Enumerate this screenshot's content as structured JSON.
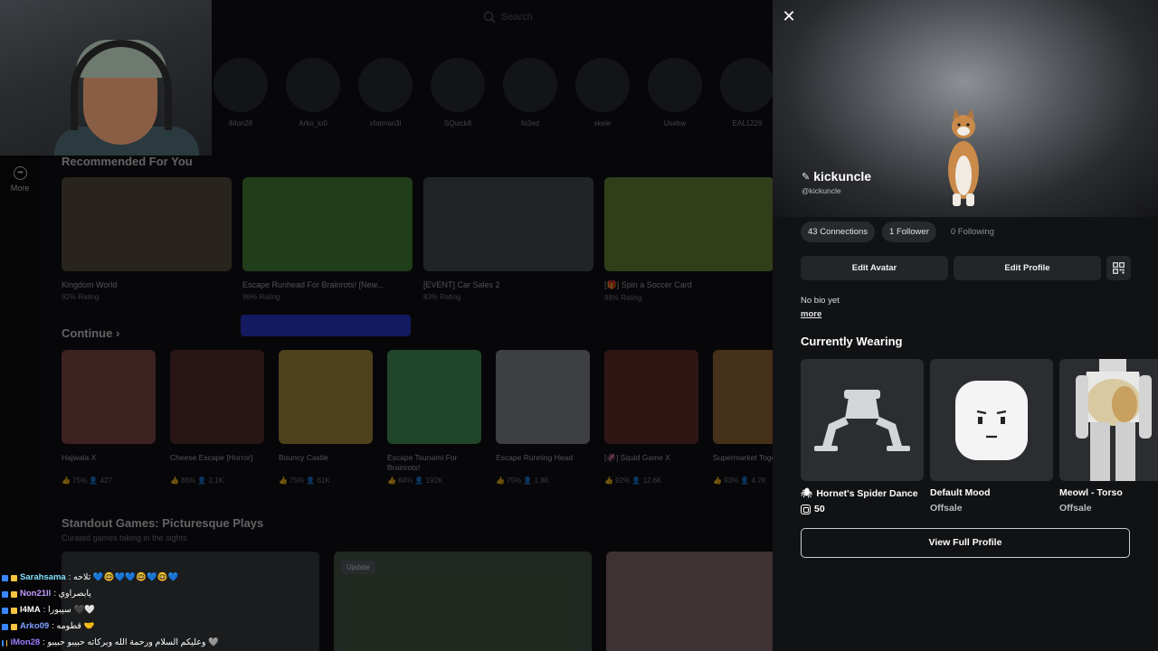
{
  "home": {
    "search_placeholder": "Search",
    "more_label": "More",
    "friends": [
      "iMon28",
      "Arko_lo0",
      "xfatman3l",
      "SQuick8",
      "fo3ed",
      "skele",
      "Usebw",
      "EAL1229"
    ],
    "recommended_title": "Recommended For You",
    "recommended": [
      {
        "title": "Kingdom World",
        "rating": "92% Rating",
        "color": "#5a5042"
      },
      {
        "title": "Escape Runhead For Brainrots! [New...",
        "rating": "96% Rating",
        "color": "#4a8a3a"
      },
      {
        "title": "[EVENT] Car Sales 2",
        "rating": "83% Rating",
        "color": "#4a5058"
      },
      {
        "title": "[🎁] Spin a Soccer Card",
        "rating": "88% Rating",
        "color": "#6a8a3a"
      }
    ],
    "continue_title": "Continue",
    "continue": [
      {
        "title": "Hajwala X",
        "stats": "👍 75%  👤 427",
        "color": "#8a4a4a"
      },
      {
        "title": "Cheese Escape [Horror]",
        "stats": "👍 86%  👤 2.1K",
        "color": "#5a3030"
      },
      {
        "title": "Bouncy Castle",
        "stats": "👍 75%  👤 61K",
        "color": "#b09040"
      },
      {
        "title": "Escape Tsunami For Brainrots!",
        "stats": "👍 84%  👤 192K",
        "color": "#4a9a5a"
      },
      {
        "title": "Escape Running Head",
        "stats": "👍 75%  👤 1.8K",
        "color": "#8a8d92"
      },
      {
        "title": "[🦑] Squid Game X",
        "stats": "👍 92%  👤 12.6K",
        "color": "#6a3030"
      },
      {
        "title": "Supermarket Together",
        "stats": "👍 93%  👤 4.7K",
        "color": "#9a6a3a"
      }
    ],
    "standout_title": "Standout Games: Picturesque Plays",
    "standout_sub": "Curated games taking in the sights",
    "standout": [
      {
        "badge": "",
        "color": "#3a3e44"
      },
      {
        "badge": "Update",
        "color": "#4a5a4a"
      },
      {
        "badge": "",
        "color": "#8a7070"
      }
    ]
  },
  "chat": [
    {
      "user": "Sarahsama",
      "color": "#7fe0ff",
      "msg": ": تلاحه 💙🤓💙💙🤓💙🤓💙"
    },
    {
      "user": "Non21ll",
      "color": "#c49cff",
      "msg": ": يابصراوي"
    },
    {
      "user": "I4MA",
      "color": "#ffffff",
      "msg": ": سيبورا 🖤🤍"
    },
    {
      "user": "Arko09",
      "color": "#7fa0ff",
      "msg": ": قطومه 🤝"
    },
    {
      "user": "iMon28",
      "color": "#9b7cff",
      "msg": ": وعليكم السلام ورحمة الله وبركاته حبيبو حبيبو 🩶"
    }
  ],
  "profile": {
    "display_name": "kickuncle",
    "handle": "@kickuncle",
    "connections": "43 Connections",
    "followers": "1 Follower",
    "following": "0 Following",
    "edit_avatar": "Edit Avatar",
    "edit_profile": "Edit Profile",
    "bio": "No bio yet",
    "more": "more",
    "currently_wearing": "Currently Wearing",
    "items": [
      {
        "name": "Hornet's Spider Dance",
        "price": "50",
        "price_type": "robux",
        "icon": "spider-emote-icon"
      },
      {
        "name": "Default Mood",
        "price": "Offsale",
        "price_type": "offsale",
        "icon": "face-icon"
      },
      {
        "name": "Meowl - Torso",
        "price": "Offsale",
        "price_type": "offsale",
        "icon": "torso-icon"
      }
    ],
    "view_full": "View Full Profile"
  }
}
